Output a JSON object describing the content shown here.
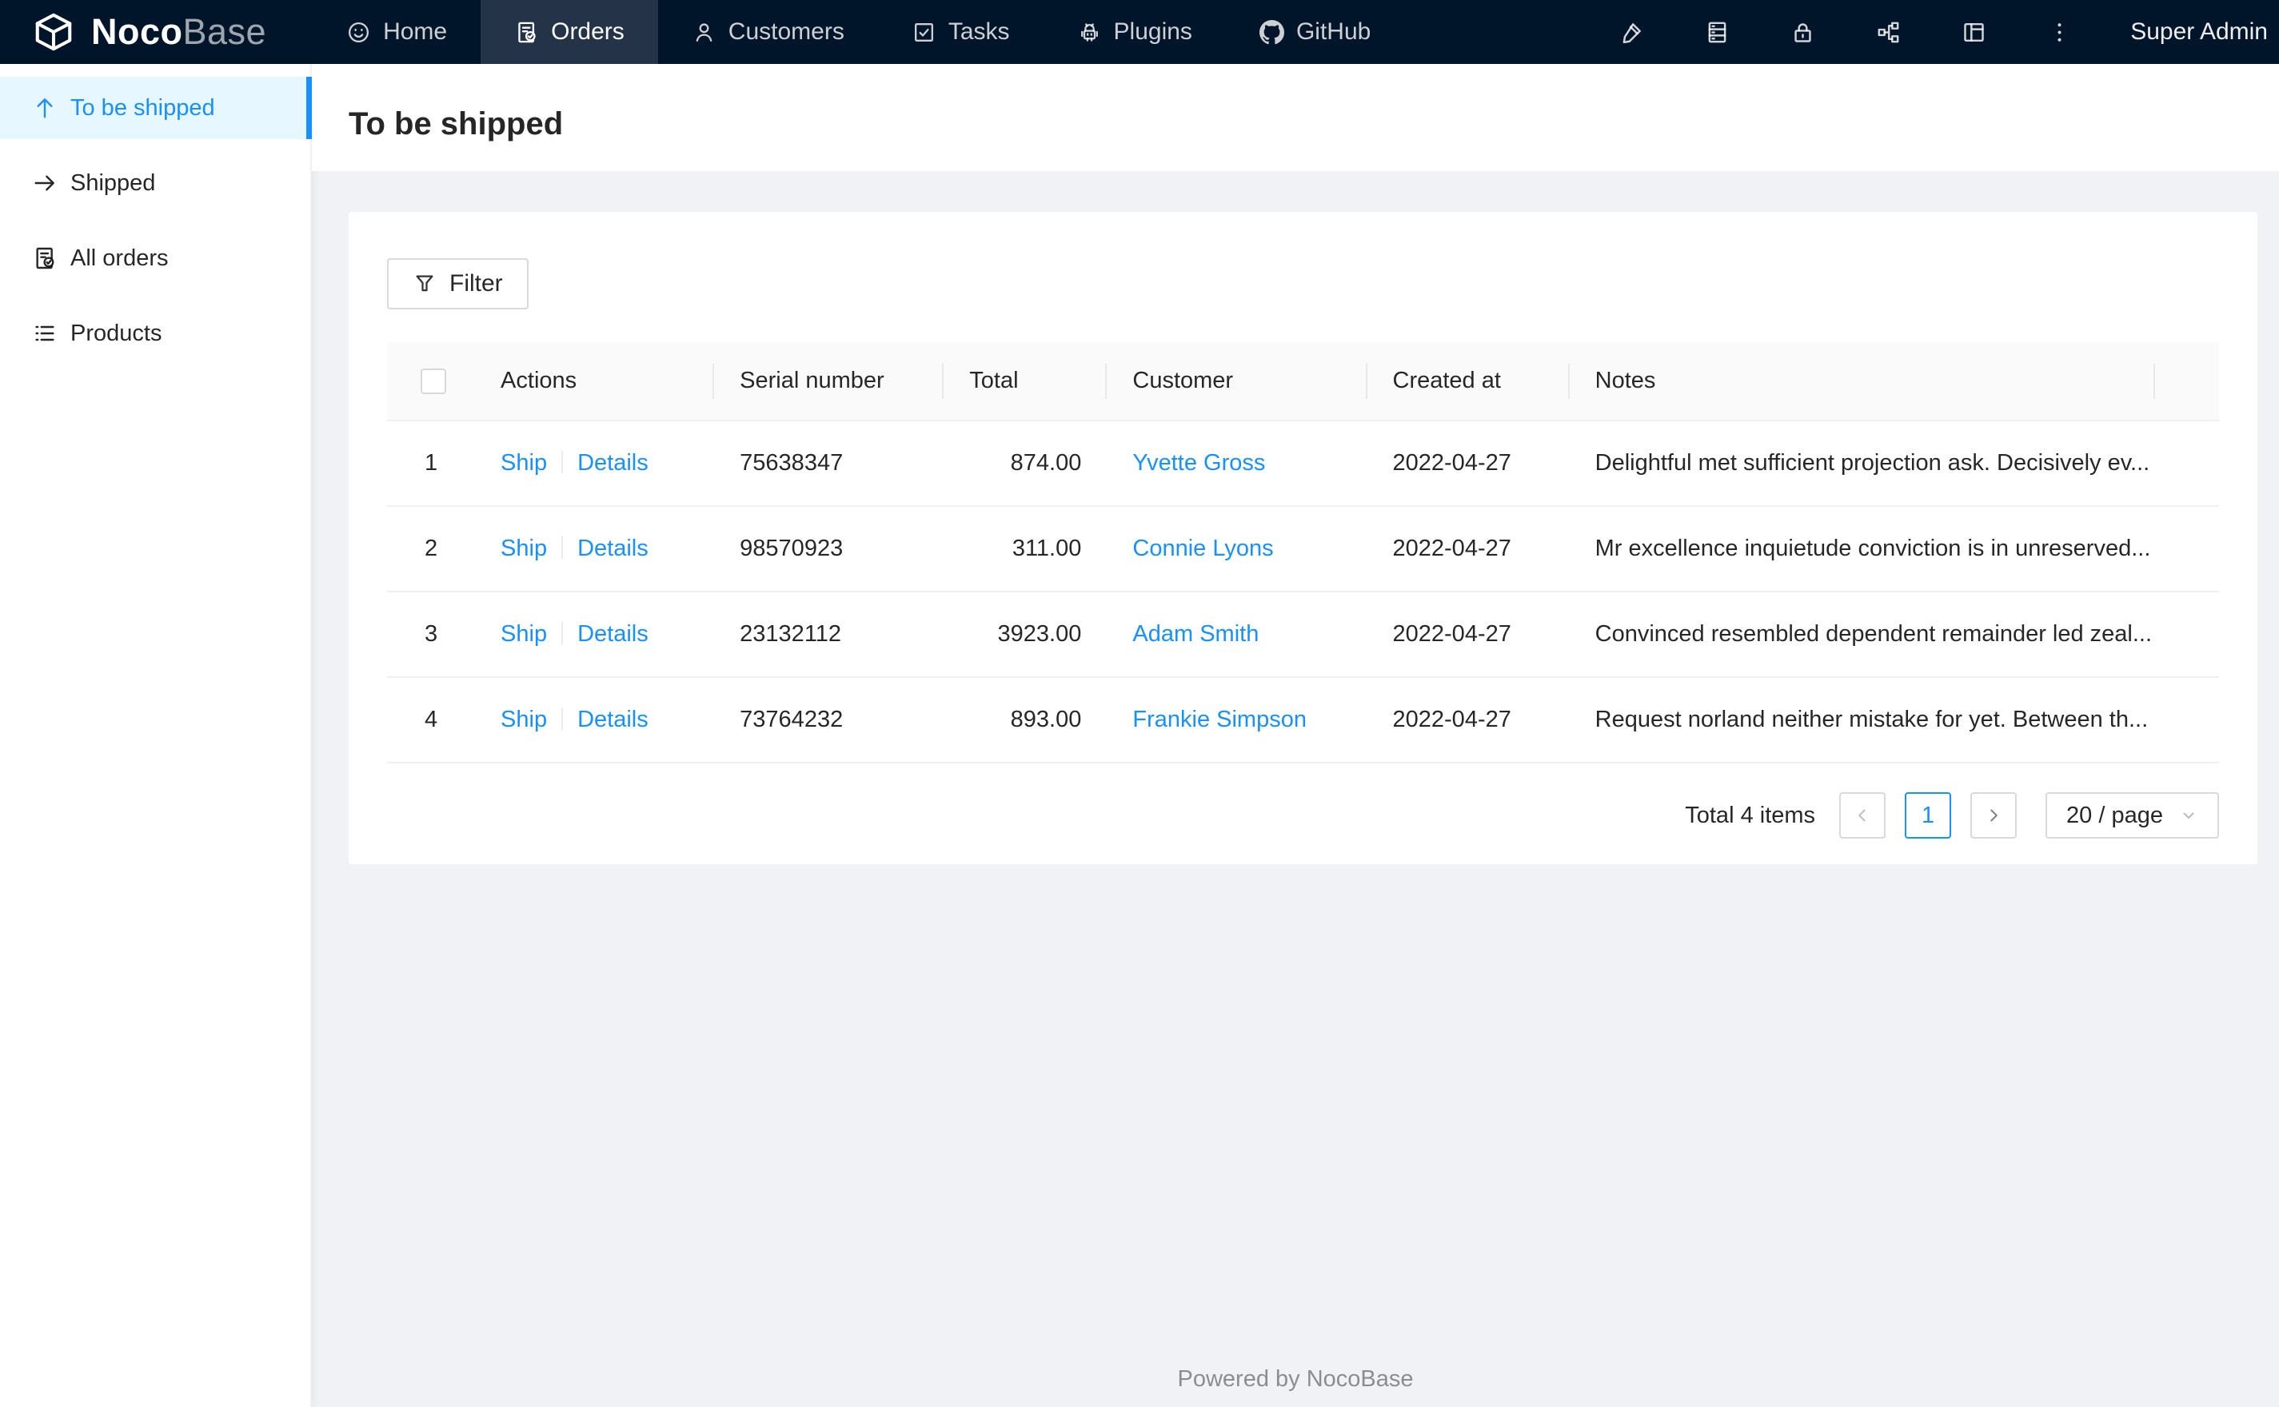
{
  "navbar": {
    "logo": {
      "icon": "cube-logo-icon",
      "text_bold": "Noco",
      "text_light": "Base"
    },
    "items": [
      {
        "id": "home",
        "label": "Home",
        "icon": "smile-icon",
        "active": false
      },
      {
        "id": "orders",
        "label": "Orders",
        "icon": "file-done-icon",
        "active": true
      },
      {
        "id": "customers",
        "label": "Customers",
        "icon": "user-icon",
        "active": false
      },
      {
        "id": "tasks",
        "label": "Tasks",
        "icon": "check-square-icon",
        "active": false
      },
      {
        "id": "plugins",
        "label": "Plugins",
        "icon": "robot-icon",
        "active": false
      },
      {
        "id": "github",
        "label": "GitHub",
        "icon": "github-icon",
        "active": false
      }
    ],
    "action_icons": [
      "highlight-pen-icon",
      "database-icon",
      "lock-icon",
      "apartment-icon",
      "layout-icon",
      "ellipsis-vertical-icon"
    ],
    "user": "Super Admin"
  },
  "sidebar": {
    "items": [
      {
        "id": "to-be-shipped",
        "label": "To be shipped",
        "icon": "arrow-up-icon",
        "active": true
      },
      {
        "id": "shipped",
        "label": "Shipped",
        "icon": "arrow-right-icon",
        "active": false
      },
      {
        "id": "all-orders",
        "label": "All orders",
        "icon": "file-done-icon",
        "active": false
      },
      {
        "id": "products",
        "label": "Products",
        "icon": "unordered-list-icon",
        "active": false
      }
    ]
  },
  "page": {
    "title": "To be shipped"
  },
  "toolbar": {
    "filter_label": "Filter",
    "filter_icon": "funnel-icon"
  },
  "table": {
    "columns": [
      "Actions",
      "Serial number",
      "Total",
      "Customer",
      "Created at",
      "Notes"
    ],
    "action_labels": [
      "Ship",
      "Details"
    ],
    "rows": [
      {
        "index": "1",
        "serial": "75638347",
        "total": "874.00",
        "customer": "Yvette Gross",
        "created_at": "2022-04-27",
        "notes": "Delightful met sufficient projection ask. Decisively ev..."
      },
      {
        "index": "2",
        "serial": "98570923",
        "total": "311.00",
        "customer": "Connie Lyons",
        "created_at": "2022-04-27",
        "notes": "Mr excellence inquietude conviction is in unreserved..."
      },
      {
        "index": "3",
        "serial": "23132112",
        "total": "3923.00",
        "customer": "Adam Smith",
        "created_at": "2022-04-27",
        "notes": "Convinced resembled dependent remainder led zeal..."
      },
      {
        "index": "4",
        "serial": "73764232",
        "total": "893.00",
        "customer": "Frankie Simpson",
        "created_at": "2022-04-27",
        "notes": "Request norland neither mistake for yet. Between th..."
      }
    ]
  },
  "pagination": {
    "total_text": "Total 4 items",
    "prev_icon": "chevron-left-icon",
    "current_page": "1",
    "next_icon": "chevron-right-icon",
    "page_size": "20 / page",
    "page_size_caret": "caret-down-icon"
  },
  "footer": {
    "text": "Powered by NocoBase"
  },
  "colors": {
    "primary": "#1890ff",
    "navbar_bg": "#001529",
    "navbar_active_bg": "#253348",
    "content_bg": "#f0f2f5",
    "sidebar_active_bg": "#e6f7ff",
    "table_header_bg": "#fafafa"
  }
}
